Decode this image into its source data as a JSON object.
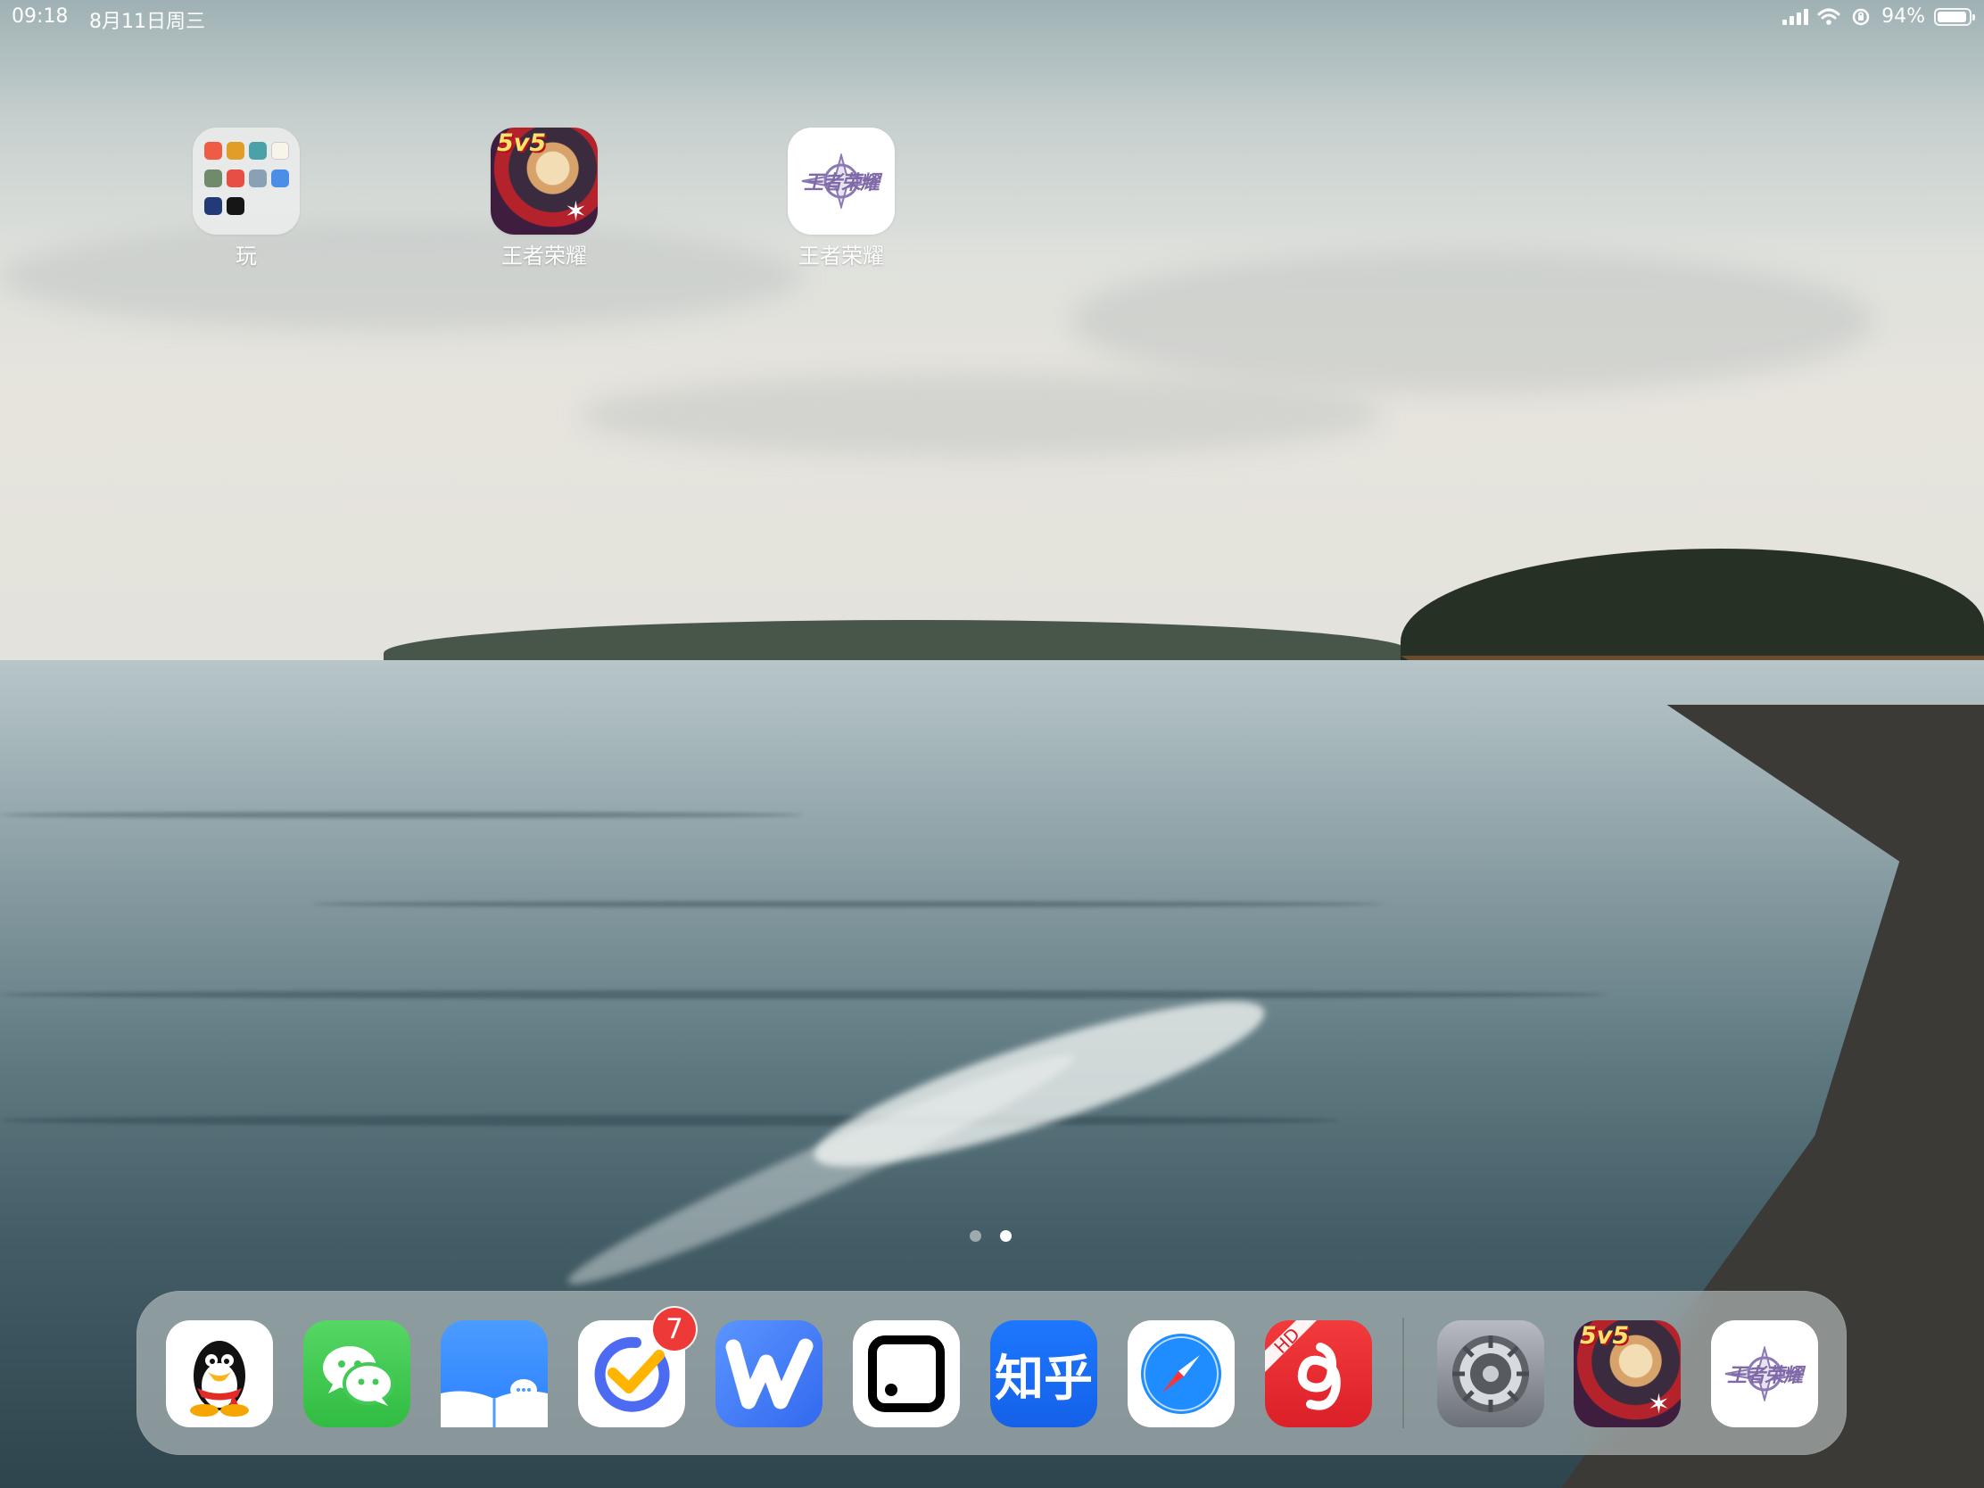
{
  "status": {
    "time": "09:18",
    "date": "8月11日周三",
    "battery": "94%",
    "icons": [
      "signal-icon",
      "wifi-icon",
      "orientation-lock-icon",
      "battery-icon"
    ],
    "battery_level": 0.94
  },
  "home_apps": [
    {
      "label": "玩",
      "icon": "folder-icon"
    },
    {
      "label": "王者荣耀",
      "icon": "honor-of-kings-icon",
      "badge_text": "5v5"
    },
    {
      "label": "王者荣耀",
      "icon": "honor-of-kings-camp-icon",
      "icon_text": "王者荣耀"
    }
  ],
  "dock": {
    "apps": [
      {
        "name": "qq-icon"
      },
      {
        "name": "wechat-icon"
      },
      {
        "name": "messages-icon"
      },
      {
        "name": "ticktick-icon",
        "badge": "7"
      },
      {
        "name": "writing-app-icon",
        "text": "W"
      },
      {
        "name": "square-app-icon"
      },
      {
        "name": "zhihu-icon",
        "text": "知乎"
      },
      {
        "name": "safari-icon"
      },
      {
        "name": "netease-music-icon",
        "text": "HD"
      },
      {
        "name": "settings-icon"
      },
      {
        "name": "honor-of-kings-dock-icon",
        "badge_text": "5v5"
      },
      {
        "name": "honor-of-kings-camp-dock-icon",
        "text": "王者荣耀"
      }
    ]
  },
  "page_indicator": {
    "pages": 2,
    "current": 2
  },
  "colors": {
    "status_text": "#ffffff",
    "badge": "#ed3a36",
    "camp_purple": "#7f6aa7"
  }
}
